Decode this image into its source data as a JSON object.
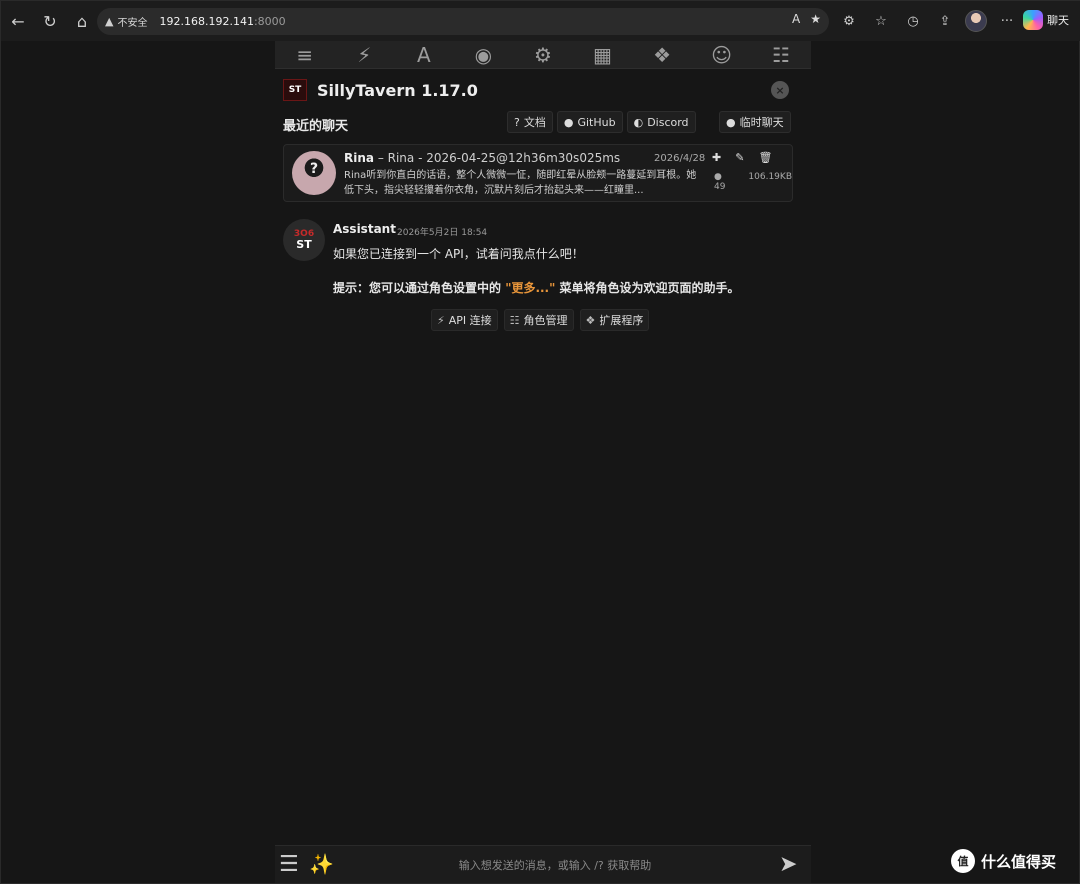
{
  "browser": {
    "nav": {
      "back": "←",
      "reload": "↻",
      "home": "⌂"
    },
    "address": {
      "warning_icon": "▲",
      "insecure_label": "不安全",
      "host": "192.168.192.141",
      "port": ":8000",
      "read_aloud": "A",
      "favorite": "★"
    },
    "tools": [
      "⚙",
      "☆",
      "◷",
      "⇪",
      "···"
    ],
    "copilot_label": "聊天"
  },
  "topbar": {
    "icons": [
      "≡",
      "⚡",
      "A",
      "◉",
      "⚙",
      "▦",
      "❖",
      "☺",
      "☷"
    ]
  },
  "panel": {
    "logo_text": "ST",
    "title": "SillyTavern 1.17.0",
    "close": "×",
    "recent_title": "最近的聊天",
    "links": [
      {
        "icon": "?",
        "label": "文档"
      },
      {
        "icon": "●",
        "label": "GitHub"
      },
      {
        "icon": "◐",
        "label": "Discord"
      }
    ],
    "temp_chat": {
      "icon": "●",
      "label": "临时聊天"
    }
  },
  "chat_card": {
    "avatar_glyph": "?",
    "name": "Rina",
    "file": " – Rina - 2026-04-25@12h36m30s025ms",
    "date": "2026/4/28",
    "preview": "Rina听到你直白的话语，整个人微微一怔，随即红晕从脸颊一路蔓延到耳根。她低下头，指尖轻轻攥着你衣角，沉默片刻后才抬起头来——红瞳里...",
    "messages_count": "● 49",
    "size": "106.19KB",
    "actions": [
      "✚",
      "✎",
      "🗑"
    ]
  },
  "message": {
    "avatar_red": "3O6",
    "avatar_st": "ST",
    "name": "Assistant",
    "time": "2026年5月2日 18:54",
    "line1": "如果您已连接到一个 API，试着问我点什么吧！",
    "line2_prefix": "提示：您可以通过角色设置中的 ",
    "line2_highlight": "\"更多...\"",
    "line2_suffix": " 菜单将角色设为欢迎页面的助手。",
    "quick_actions": [
      {
        "icon": "⚡",
        "label": "API 连接"
      },
      {
        "icon": "☷",
        "label": "角色管理"
      },
      {
        "icon": "❖",
        "label": "扩展程序"
      }
    ]
  },
  "input": {
    "menu_icon": "☰",
    "wand_icon": "✨",
    "placeholder": "输入想发送的消息，或输入 /? 获取帮助",
    "send_icon": "➤"
  },
  "watermark": {
    "logo": "值",
    "text": "什么值得买"
  }
}
